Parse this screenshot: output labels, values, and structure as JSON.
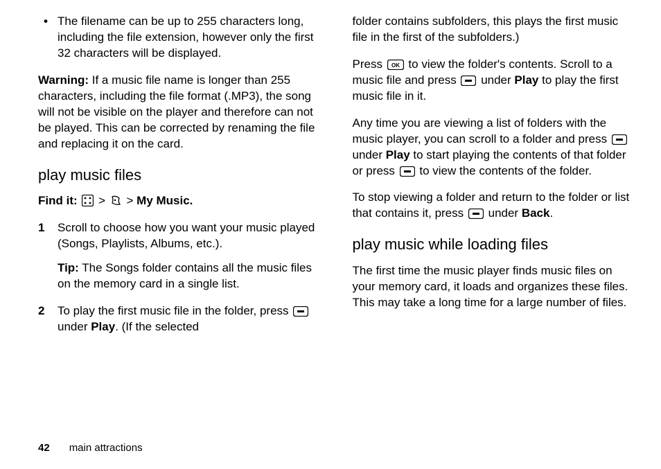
{
  "col1": {
    "bullet1": "The filename can be up to 255 characters long, including the file extension, however only the first 32 characters will be displayed.",
    "warning_label": "Warning:",
    "warning_text": " If a music file name is longer than 255 characters, including the file format (.MP3), the song will not be visible on the player and therefore can not be played. This can be corrected by renaming the file and replacing it on the card.",
    "h_play": "play music files",
    "findit_label": "Find it: ",
    "findit_gt1": " > ",
    "findit_gt2": "> ",
    "findit_end": "My Music.",
    "step1_num": "1",
    "step1": "Scroll to choose how you want your music played (Songs, Playlists, Albums, etc.).",
    "tip_label": "Tip:",
    "tip_text": " The Songs folder contains all the music files on the memory card in a single list.",
    "step2_num": "2",
    "step2_a": "To play the first music file in the folder, press ",
    "step2_b": " under ",
    "step2_play": "Play",
    "step2_c": ". (If the selected"
  },
  "col2": {
    "cont1": "folder contains subfolders, this plays the first music file in the first of the subfolders.)",
    "p2_a": "Press ",
    "p2_b": " to view the folder's contents. Scroll to a music file and press ",
    "p2_c": " under ",
    "p2_play": "Play",
    "p2_d": " to play the first music file in it.",
    "p3_a": "Any time you are viewing a list of folders with the music player, you can scroll to a folder and press ",
    "p3_b": " under ",
    "p3_play": "Play",
    "p3_c": " to start playing the contents of that folder or press ",
    "p3_d": " to view the contents of the folder.",
    "p4_a": "To stop viewing a folder and return to the folder or list that contains it, press ",
    "p4_b": " under ",
    "p4_back": "Back",
    "p4_c": ".",
    "h_load": "play music while loading files",
    "p5": "The first time the music player finds music files on your memory card, it loads and organizes these files. This may take a long time for a large number of files."
  },
  "footer": {
    "page": "42",
    "section": "main attractions"
  }
}
